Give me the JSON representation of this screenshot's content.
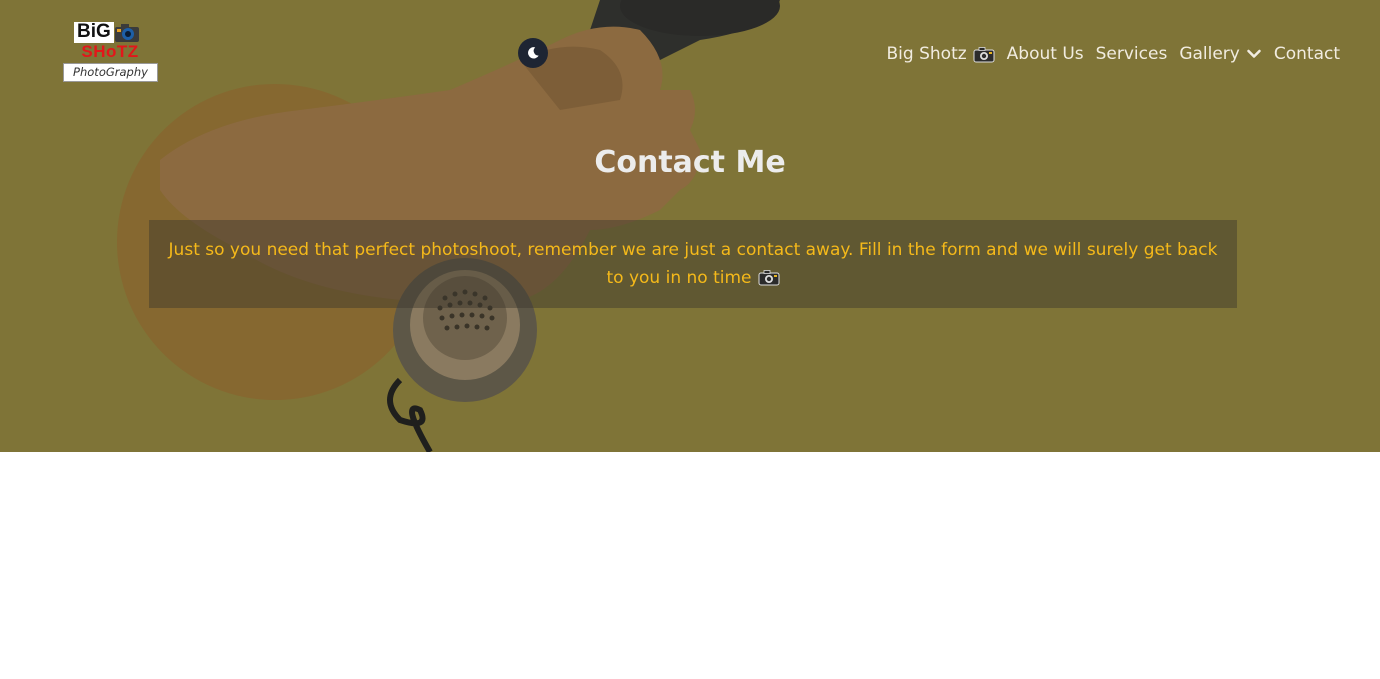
{
  "logo": {
    "line1": "BiG",
    "line2": "SHoTZ",
    "line3": "PhotoGraphy"
  },
  "theme_toggle": {
    "icon": "moon-icon"
  },
  "nav": {
    "items": [
      {
        "label": "Big Shotz",
        "icon": "camera-icon"
      },
      {
        "label": "About Us"
      },
      {
        "label": "Services"
      },
      {
        "label": "Gallery",
        "icon": "chevron-down-icon"
      },
      {
        "label": "Contact"
      }
    ]
  },
  "hero": {
    "title": "Contact Me",
    "message": "Just so you need that perfect photoshoot, remember we are just a contact away. Fill in the form and we will surely get back to you in no time",
    "message_icon": "camera-icon"
  },
  "colors": {
    "hero_overlay": "#7f7437",
    "accent_text": "#f5b91a",
    "logo_red": "#e3161a",
    "toggle_bg": "#1e2533"
  }
}
